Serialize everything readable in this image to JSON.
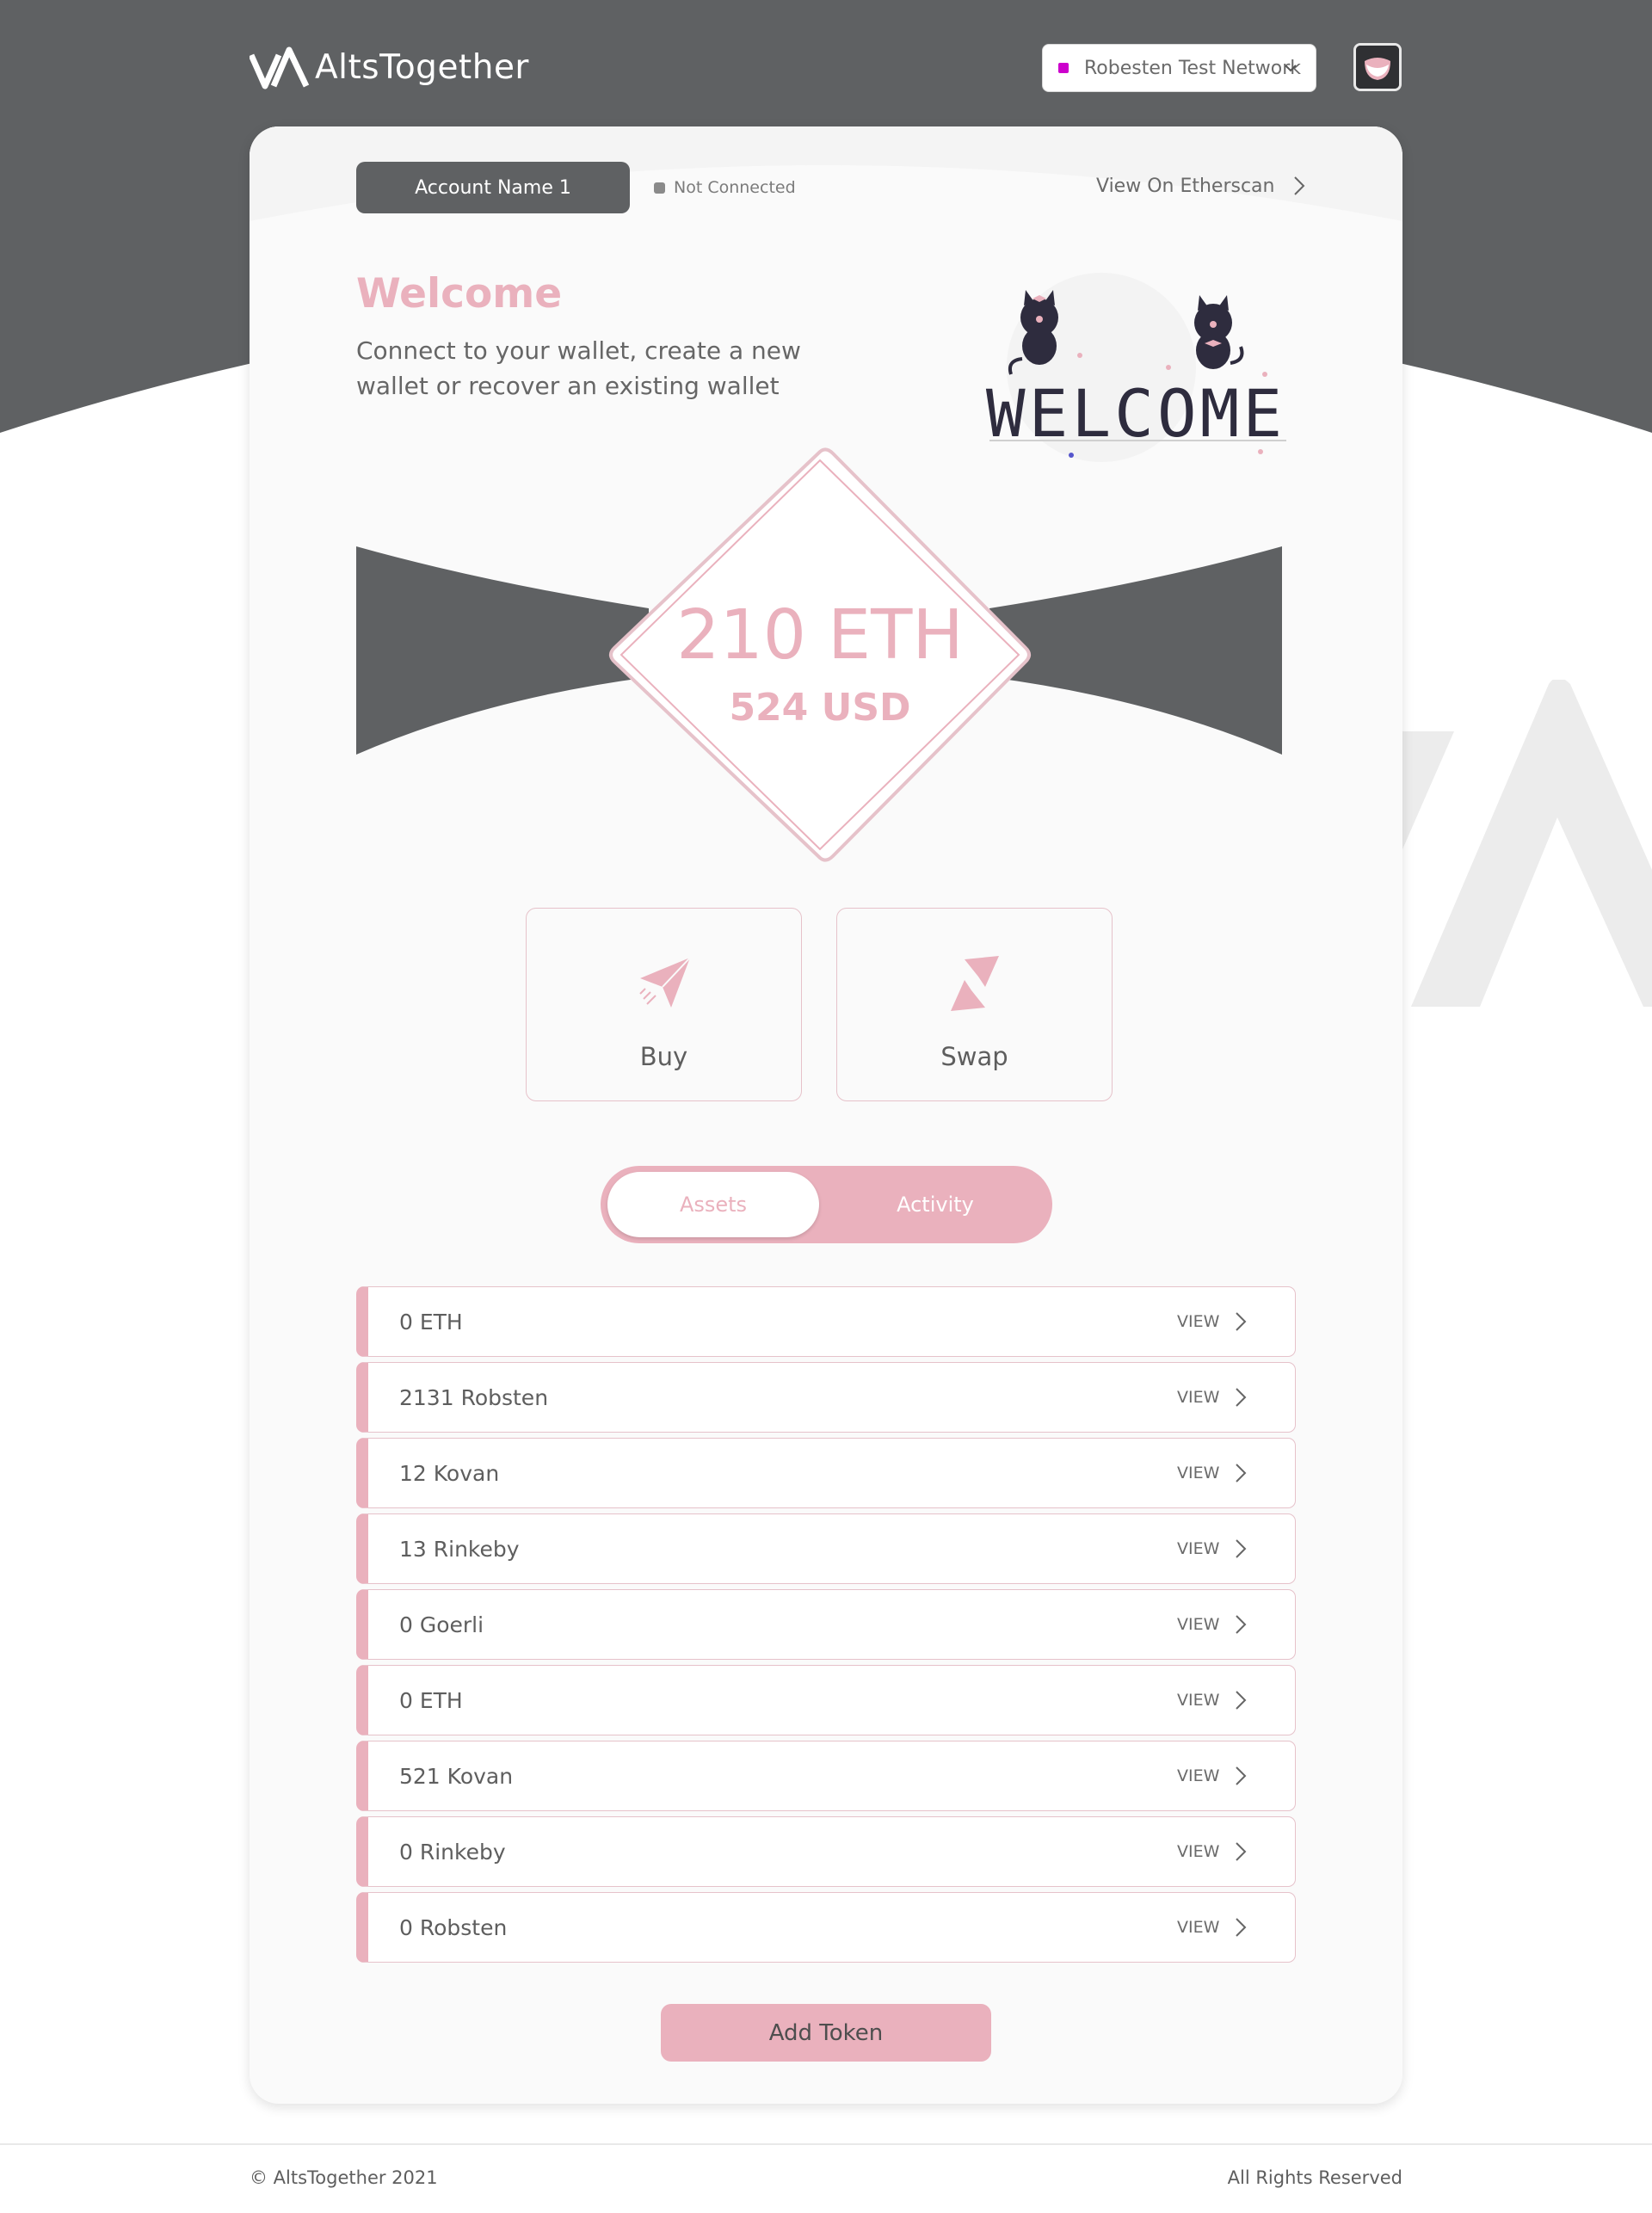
{
  "header": {
    "brand": "AltsTogether",
    "network": {
      "label": "Robesten Test Network",
      "dot_color": "#cc00cc"
    }
  },
  "account": {
    "name": "Account Name 1",
    "status": "Not Connected",
    "explorer_link": "View On Etherscan"
  },
  "welcome": {
    "title": "Welcome",
    "subtitle": "Connect to your wallet, create a new wallet or recover an existing wallet",
    "illustration_text": "WELCOME"
  },
  "balance": {
    "eth": "210 ETH",
    "usd": "524 USD"
  },
  "actions": [
    {
      "label": "Buy",
      "icon": "paper-plane-icon"
    },
    {
      "label": "Swap",
      "icon": "swap-arrows-icon"
    }
  ],
  "tabs": [
    {
      "label": "Assets",
      "active": true
    },
    {
      "label": "Activity",
      "active": false
    }
  ],
  "assets": [
    {
      "label": "0 ETH",
      "action": "VIEW"
    },
    {
      "label": "2131 Robsten",
      "action": "VIEW"
    },
    {
      "label": "12 Kovan",
      "action": "VIEW"
    },
    {
      "label": "13 Rinkeby",
      "action": "VIEW"
    },
    {
      "label": "0 Goerli",
      "action": "VIEW"
    },
    {
      "label": "0 ETH",
      "action": "VIEW"
    },
    {
      "label": "521 Kovan",
      "action": "VIEW"
    },
    {
      "label": "0 Rinkeby",
      "action": "VIEW"
    },
    {
      "label": "0 Robsten",
      "action": "VIEW"
    }
  ],
  "add_token_label": "Add Token",
  "footer": {
    "left": "© AltsTogether 2021",
    "right": "All Rights Reserved"
  },
  "colors": {
    "accent_pink": "#eab1bd",
    "dark_gray": "#5f6163",
    "text": "#5e5e5e"
  }
}
